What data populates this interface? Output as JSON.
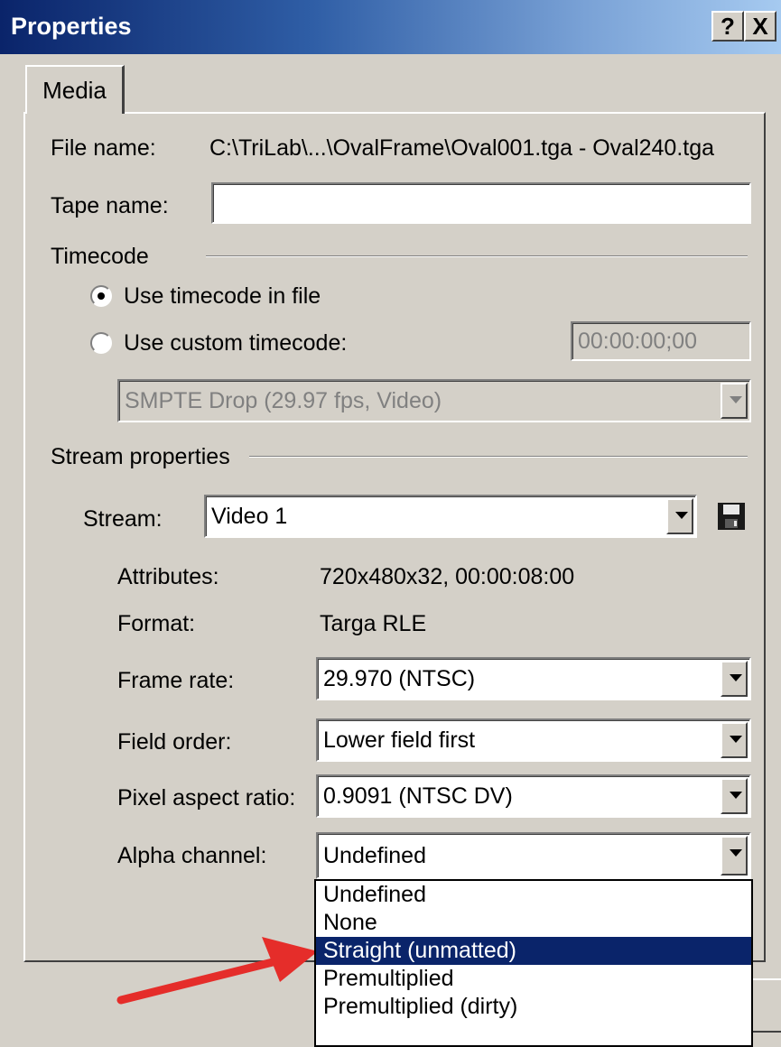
{
  "window": {
    "title": "Properties",
    "help_label": "?",
    "close_label": "X"
  },
  "tab": {
    "label": "Media"
  },
  "file": {
    "label": "File name:",
    "value": "C:\\TriLab\\...\\OvalFrame\\Oval001.tga - Oval240.tga"
  },
  "tape": {
    "label": "Tape name:",
    "value": ""
  },
  "timecode": {
    "heading": "Timecode",
    "option_file": "Use timecode in file",
    "option_custom": "Use custom timecode:",
    "selected": "option_file",
    "custom_value": "00:00:00;00",
    "format_value": "SMPTE Drop (29.97 fps, Video)"
  },
  "stream_props": {
    "heading": "Stream properties",
    "stream_label": "Stream:",
    "stream_value": "Video 1",
    "save_icon": "save-icon",
    "attributes_label": "Attributes:",
    "attributes_value": "720x480x32, 00:00:08:00",
    "format_label": "Format:",
    "format_value": "Targa RLE",
    "frame_rate_label": "Frame rate:",
    "frame_rate_value": "29.970 (NTSC)",
    "field_order_label": "Field order:",
    "field_order_value": "Lower field first",
    "par_label": "Pixel aspect ratio:",
    "par_value": "0.9091 (NTSC DV)",
    "alpha_label": "Alpha channel:",
    "alpha_value": "Undefined"
  },
  "alpha_options": [
    "Undefined",
    "None",
    "Straight (unmatted)",
    "Premultiplied",
    "Premultiplied (dirty)"
  ],
  "alpha_highlighted_index": 2,
  "colors": {
    "highlight": "#0a246a",
    "arrow": "#e52d2a",
    "face": "#d4d0c8"
  }
}
